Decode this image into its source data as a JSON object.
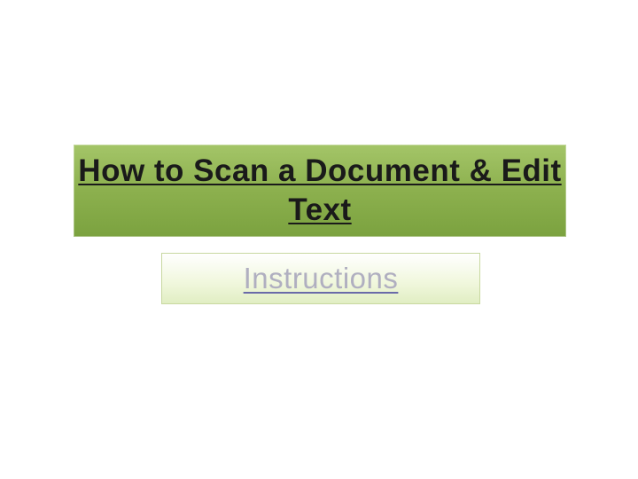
{
  "title": {
    "text": "How to Scan a Document & Edit Text"
  },
  "link": {
    "label": "Instructions"
  }
}
